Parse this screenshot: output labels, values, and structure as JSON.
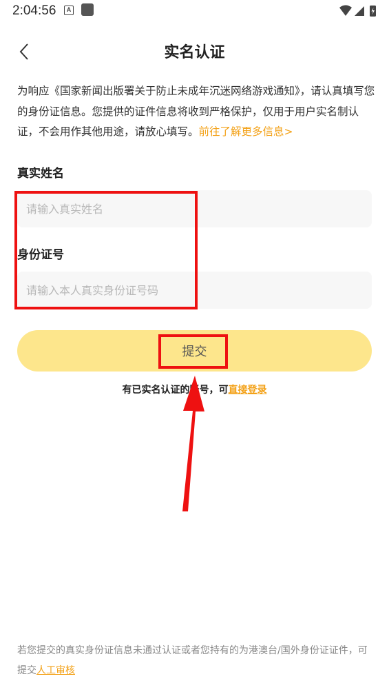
{
  "status_bar": {
    "time": "2:04:56",
    "notification_badge": "A"
  },
  "nav": {
    "title": "实名认证",
    "back_icon": "chevron-left-icon"
  },
  "notice": {
    "text": "为响应《国家新闻出版署关于防止未成年沉迷网络游戏通知》，请认真填写您的身份证信息。您提供的证件信息将收到严格保护，仅用于用户实名制认证，不会用作其他用途，请放心填写。",
    "link_text": "前往了解更多信息>"
  },
  "form": {
    "name_label": "真实姓名",
    "name_placeholder": "请输入真实姓名",
    "id_label": "身份证号",
    "id_placeholder": "请输入本人真实身份证号码",
    "submit_label": "提交"
  },
  "login": {
    "prefix": "有已实名认证的账号，可",
    "link_text": "直接登录"
  },
  "footer": {
    "text": "若您提交的真实身份证信息未通过认证或者您持有的为港澳台/国外身份证证件，可提交",
    "link_text": "人工审核"
  },
  "colors": {
    "accent": "#f3a117",
    "button": "#fde68c",
    "input_bg": "#f7f7f7",
    "annotation": "#ee1111"
  }
}
